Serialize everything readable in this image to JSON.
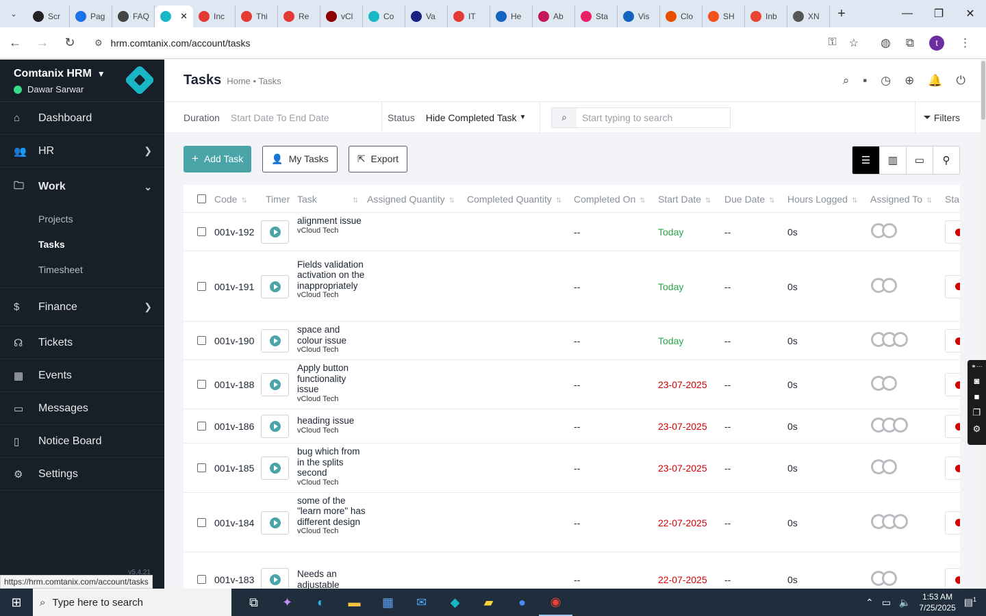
{
  "browser": {
    "tabs": [
      {
        "label": "Scr",
        "color": "#222"
      },
      {
        "label": "Pag",
        "color": "#1a73e8"
      },
      {
        "label": "FAQ",
        "color": "#444"
      },
      {
        "label": "",
        "color": "#19b6c6",
        "active": true
      },
      {
        "label": "Inc",
        "color": "#e53935"
      },
      {
        "label": "Thi",
        "color": "#e53935"
      },
      {
        "label": "Re",
        "color": "#e53935"
      },
      {
        "label": "vCl",
        "color": "#8e0000"
      },
      {
        "label": "Co",
        "color": "#19b6c6"
      },
      {
        "label": "Va",
        "color": "#1a237e"
      },
      {
        "label": "IT",
        "color": "#e53935"
      },
      {
        "label": "He",
        "color": "#1565c0"
      },
      {
        "label": "Ab",
        "color": "#c2185b"
      },
      {
        "label": "Sta",
        "color": "#e91e63"
      },
      {
        "label": "Vis",
        "color": "#1565c0"
      },
      {
        "label": "Clo",
        "color": "#e65100"
      },
      {
        "label": "SH",
        "color": "#f4511e"
      },
      {
        "label": "Inb",
        "color": "#ea4335"
      },
      {
        "label": "XN",
        "color": "#555"
      }
    ],
    "url": "hrm.comtanix.com/account/tasks",
    "status_url": "https://hrm.comtanix.com/account/tasks",
    "profile_initial": "t"
  },
  "sidebar": {
    "company": "Comtanix HRM",
    "user": "Dawar Sarwar",
    "items": [
      {
        "label": "Dashboard",
        "icon": "home-icon"
      },
      {
        "label": "HR",
        "icon": "people-icon"
      },
      {
        "label": "Work",
        "icon": "briefcase-icon"
      },
      {
        "label": "Finance",
        "icon": "dollar-icon"
      },
      {
        "label": "Tickets",
        "icon": "headset-icon"
      },
      {
        "label": "Events",
        "icon": "calendar-icon"
      },
      {
        "label": "Messages",
        "icon": "message-icon"
      },
      {
        "label": "Notice Board",
        "icon": "clipboard-icon"
      },
      {
        "label": "Settings",
        "icon": "gear-icon"
      }
    ],
    "work_sub": [
      "Projects",
      "Tasks",
      "Timesheet"
    ],
    "version": "v5.4.21"
  },
  "header": {
    "title": "Tasks",
    "breadcrumb": "Home • Tasks"
  },
  "filters": {
    "duration_label": "Duration",
    "duration_value": "Start Date To End Date",
    "status_label": "Status",
    "status_value": "Hide Completed Task",
    "search_placeholder": "Start typing to search",
    "filters_label": "Filters"
  },
  "actions": {
    "add": "Add Task",
    "my_tasks": "My Tasks",
    "export": "Export"
  },
  "table": {
    "columns": [
      "Code",
      "Timer",
      "Task",
      "Assigned Quantity",
      "Completed Quantity",
      "Completed On",
      "Start Date",
      "Due Date",
      "Hours Logged",
      "Assigned To",
      "Sta"
    ],
    "rows": [
      {
        "code": "001v-192",
        "task": "alignment issue",
        "project": "vCloud Tech",
        "completed_on": "--",
        "start": "Today",
        "start_color": "green",
        "due": "--",
        "hours": "0s",
        "avatars": 2
      },
      {
        "code": "001v-191",
        "task": "Fields validation activation on the inappropriately",
        "project": "vCloud Tech",
        "completed_on": "--",
        "start": "Today",
        "start_color": "green",
        "due": "--",
        "hours": "0s",
        "avatars": 2
      },
      {
        "code": "001v-190",
        "task": "space and colour issue",
        "project": "vCloud Tech",
        "completed_on": "--",
        "start": "Today",
        "start_color": "green",
        "due": "--",
        "hours": "0s",
        "avatars": 3
      },
      {
        "code": "001v-188",
        "task": "Apply button functionality issue",
        "project": "vCloud Tech",
        "completed_on": "--",
        "start": "23-07-2025",
        "start_color": "red",
        "due": "--",
        "hours": "0s",
        "avatars": 2
      },
      {
        "code": "001v-186",
        "task": "heading issue",
        "project": "vCloud Tech",
        "completed_on": "--",
        "start": "23-07-2025",
        "start_color": "red",
        "due": "--",
        "hours": "0s",
        "avatars": 3
      },
      {
        "code": "001v-185",
        "task": "bug which from in the splits second",
        "project": "vCloud Tech",
        "completed_on": "--",
        "start": "23-07-2025",
        "start_color": "red",
        "due": "--",
        "hours": "0s",
        "avatars": 2
      },
      {
        "code": "001v-184",
        "task": "some of the \"learn more\" has different design",
        "project": "vCloud Tech",
        "completed_on": "--",
        "start": "22-07-2025",
        "start_color": "red",
        "due": "--",
        "hours": "0s",
        "avatars": 3
      },
      {
        "code": "001v-183",
        "task": "Needs an adjustable space",
        "project": "",
        "completed_on": "--",
        "start": "22-07-2025",
        "start_color": "red",
        "due": "--",
        "hours": "0s",
        "avatars": 2
      }
    ]
  },
  "taskbar": {
    "search_placeholder": "Type here to search",
    "time": "1:53 AM",
    "date": "7/25/2025",
    "notifications": "1"
  }
}
